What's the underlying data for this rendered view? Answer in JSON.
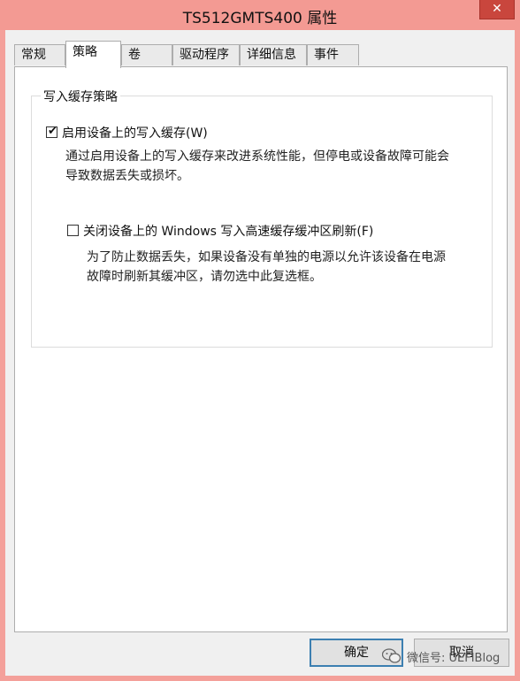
{
  "window": {
    "title": "TS512GMTS400 属性",
    "close_glyph": "✕"
  },
  "tabs": [
    {
      "label": "常规",
      "active": false
    },
    {
      "label": "策略",
      "active": true
    },
    {
      "label": "卷",
      "active": false
    },
    {
      "label": "驱动程序",
      "active": false
    },
    {
      "label": "详细信息",
      "active": false
    },
    {
      "label": "事件",
      "active": false
    }
  ],
  "group": {
    "label": "写入缓存策略",
    "enable_cache": {
      "label": "启用设备上的写入缓存(W)",
      "checked": true,
      "description_line1": "通过启用设备上的写入缓存来改进系统性能，但停电或设备故障可能会",
      "description_line2": "导致数据丢失或损坏。"
    },
    "disable_flush": {
      "label": "关闭设备上的 Windows 写入高速缓存缓冲区刷新(F)",
      "checked": false,
      "description_line1": "为了防止数据丢失，如果设备没有单独的电源以允许该设备在电源",
      "description_line2": "故障时刷新其缓冲区，请勿选中此复选框。"
    }
  },
  "buttons": {
    "ok_label": "确定",
    "cancel_label": "取消"
  },
  "watermark": {
    "text": "微信号: UEFIBlog",
    "icon": "wechat-icon"
  }
}
